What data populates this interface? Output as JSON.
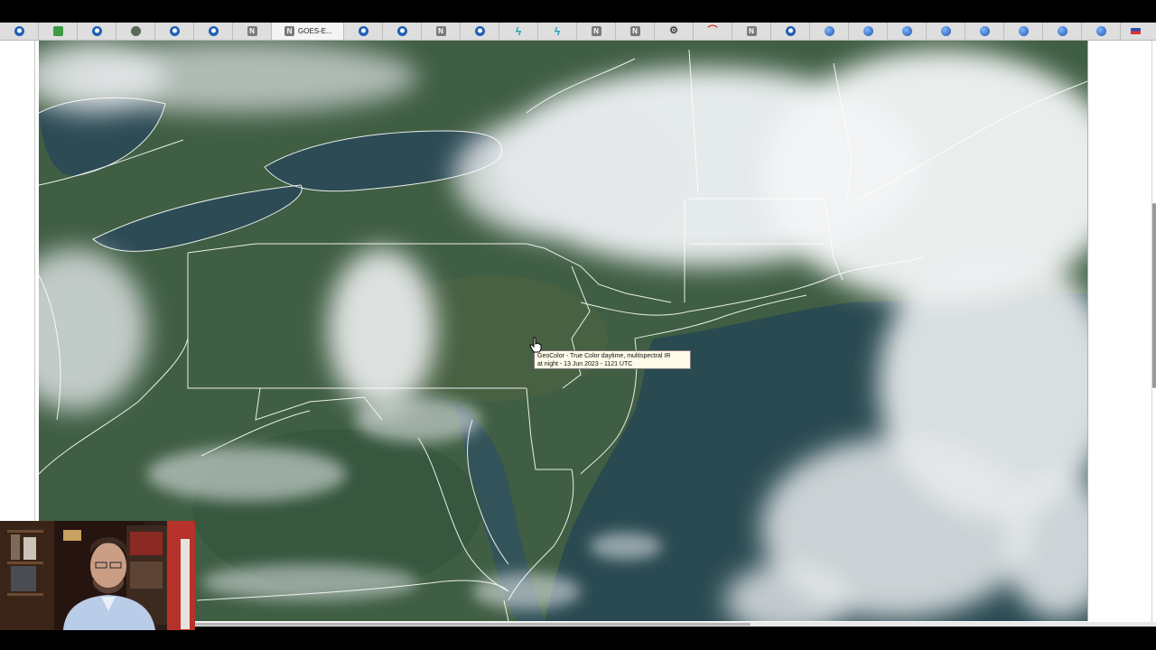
{
  "browser": {
    "active_tab_title": "GOES-E...",
    "tabs": [
      {
        "icon": "noaa-icon",
        "cls": "noaa"
      },
      {
        "icon": "green-doc-icon",
        "cls": "green"
      },
      {
        "icon": "noaa-icon",
        "cls": "noaa"
      },
      {
        "icon": "cyclone-icon",
        "cls": "cyc"
      },
      {
        "icon": "noaa-icon",
        "cls": "noaa"
      },
      {
        "icon": "noaa-icon",
        "cls": "noaa"
      },
      {
        "icon": "n-icon",
        "cls": "n",
        "glyph": "N"
      },
      {
        "icon": "n-icon",
        "cls": "n",
        "glyph": "N",
        "active": true
      },
      {
        "icon": "noaa-icon",
        "cls": "noaa"
      },
      {
        "icon": "noaa-icon",
        "cls": "noaa"
      },
      {
        "icon": "n-icon",
        "cls": "n",
        "glyph": "N"
      },
      {
        "icon": "noaa-icon",
        "cls": "noaa"
      },
      {
        "icon": "bolt-icon",
        "cls": "bolt",
        "glyph": "ϟ"
      },
      {
        "icon": "bolt-icon",
        "cls": "bolt",
        "glyph": "ϟ"
      },
      {
        "icon": "n-icon",
        "cls": "n",
        "glyph": "N"
      },
      {
        "icon": "n-icon",
        "cls": "n",
        "glyph": "N"
      },
      {
        "icon": "gear-icon",
        "cls": "gear",
        "glyph": "⚙"
      },
      {
        "icon": "red-swoosh-icon",
        "cls": "red",
        "glyph": "⌒"
      },
      {
        "icon": "n-icon",
        "cls": "n",
        "glyph": "N"
      },
      {
        "icon": "noaa-icon",
        "cls": "noaa"
      },
      {
        "icon": "globe-icon",
        "cls": "globe"
      },
      {
        "icon": "globe-icon",
        "cls": "globe"
      },
      {
        "icon": "globe-icon",
        "cls": "globe"
      },
      {
        "icon": "globe-icon",
        "cls": "globe"
      },
      {
        "icon": "globe-icon",
        "cls": "globe"
      },
      {
        "icon": "globe-icon",
        "cls": "globe"
      },
      {
        "icon": "globe-icon",
        "cls": "globe"
      },
      {
        "icon": "globe-icon",
        "cls": "globe"
      },
      {
        "icon": "flag-icon",
        "cls": "flag",
        "last": true
      }
    ]
  },
  "tooltip": {
    "line1": "GeoColor - True Color daytime, multispectral IR",
    "line2": "at night - 13 Jun 2023 - 1121 UTC"
  },
  "colors": {
    "land": "#3f5e43",
    "ocean": "#2a4a52",
    "cloud": "#eef1f3",
    "border_lines": "#ffffff"
  }
}
